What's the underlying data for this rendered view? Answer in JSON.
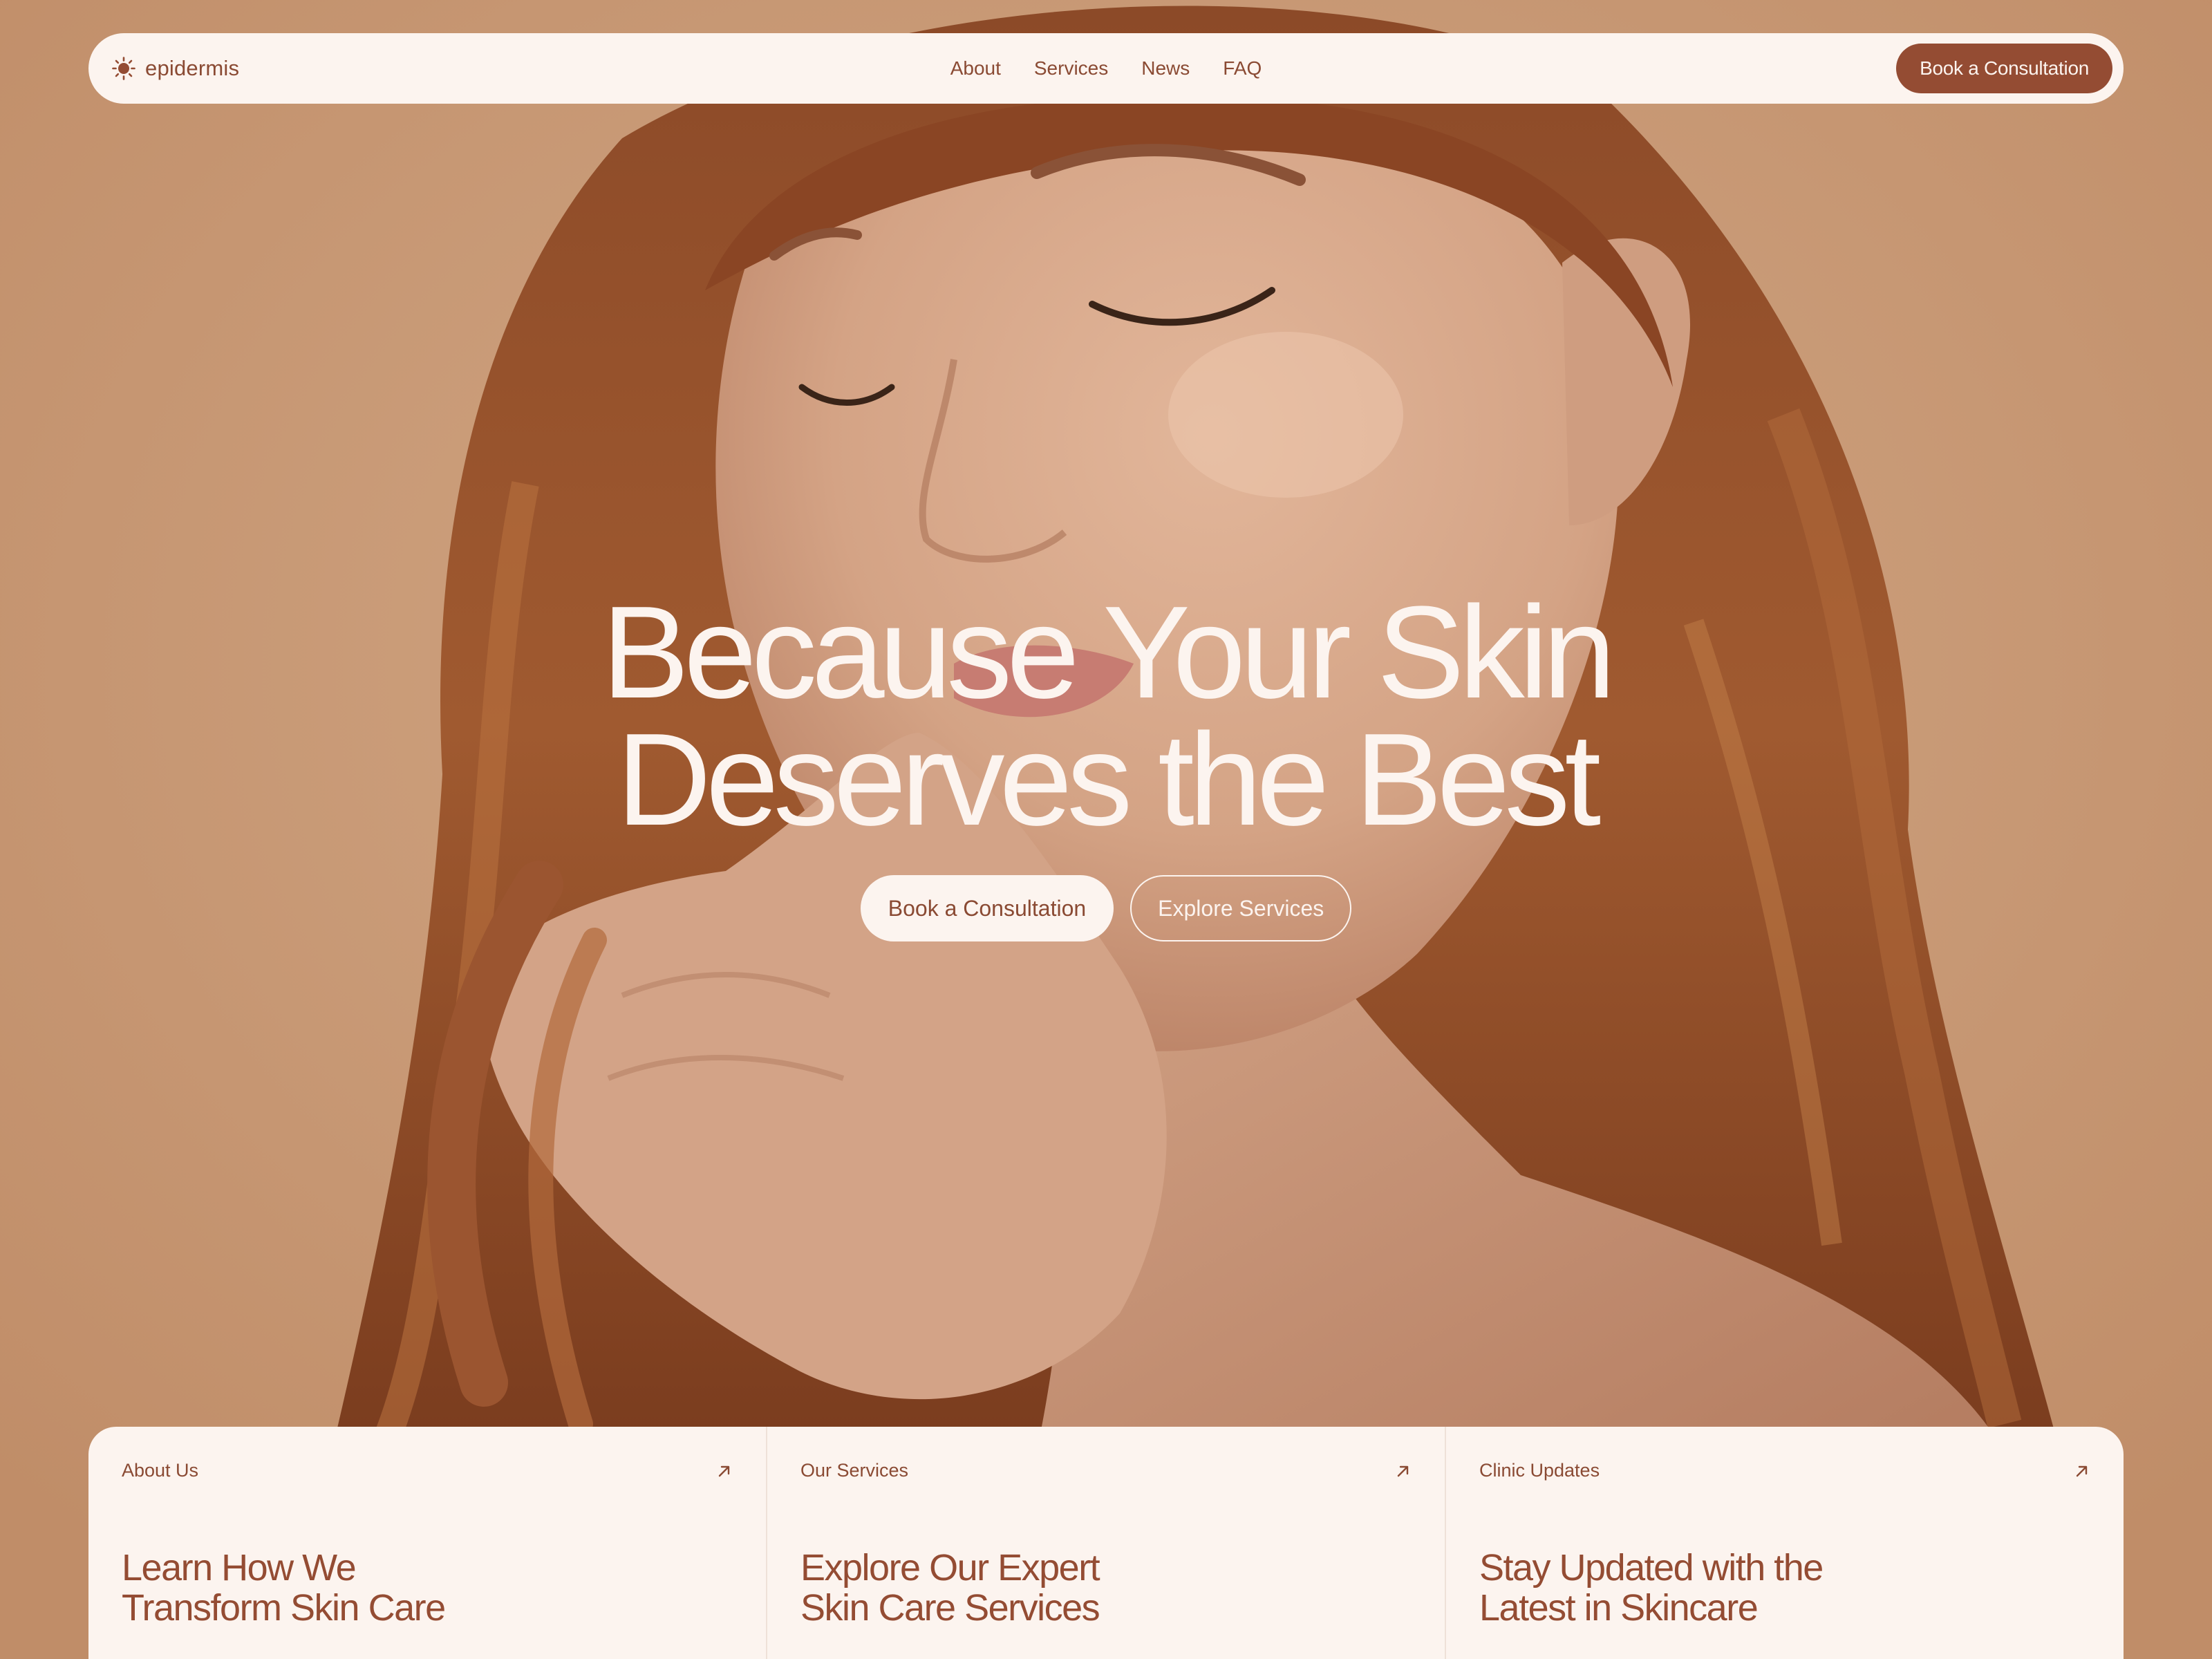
{
  "brand": {
    "name": "epidermis",
    "icon": "sun-icon"
  },
  "nav": {
    "links": [
      "About",
      "Services",
      "News",
      "FAQ"
    ],
    "cta_label": "Book a Consultation"
  },
  "hero": {
    "title_line1": "Because Your Skin",
    "title_line2": "Deserves the Best",
    "primary_label": "Book a Consultation",
    "secondary_label": "Explore Services",
    "image": "woman-with-auburn-hair-portrait"
  },
  "cards": [
    {
      "label": "About Us",
      "title": "Learn How We Transform Skin Care",
      "icon": "arrow-up-right-icon"
    },
    {
      "label": "Our Services",
      "title": "Explore Our Expert Skin Care Services",
      "icon": "arrow-up-right-icon"
    },
    {
      "label": "Clinic Updates",
      "title": "Stay Updated with the Latest in Skincare",
      "icon": "arrow-up-right-icon"
    }
  ],
  "colors": {
    "accent": "#944c33",
    "cream": "#fcf4ef",
    "background": "#c99a74"
  }
}
